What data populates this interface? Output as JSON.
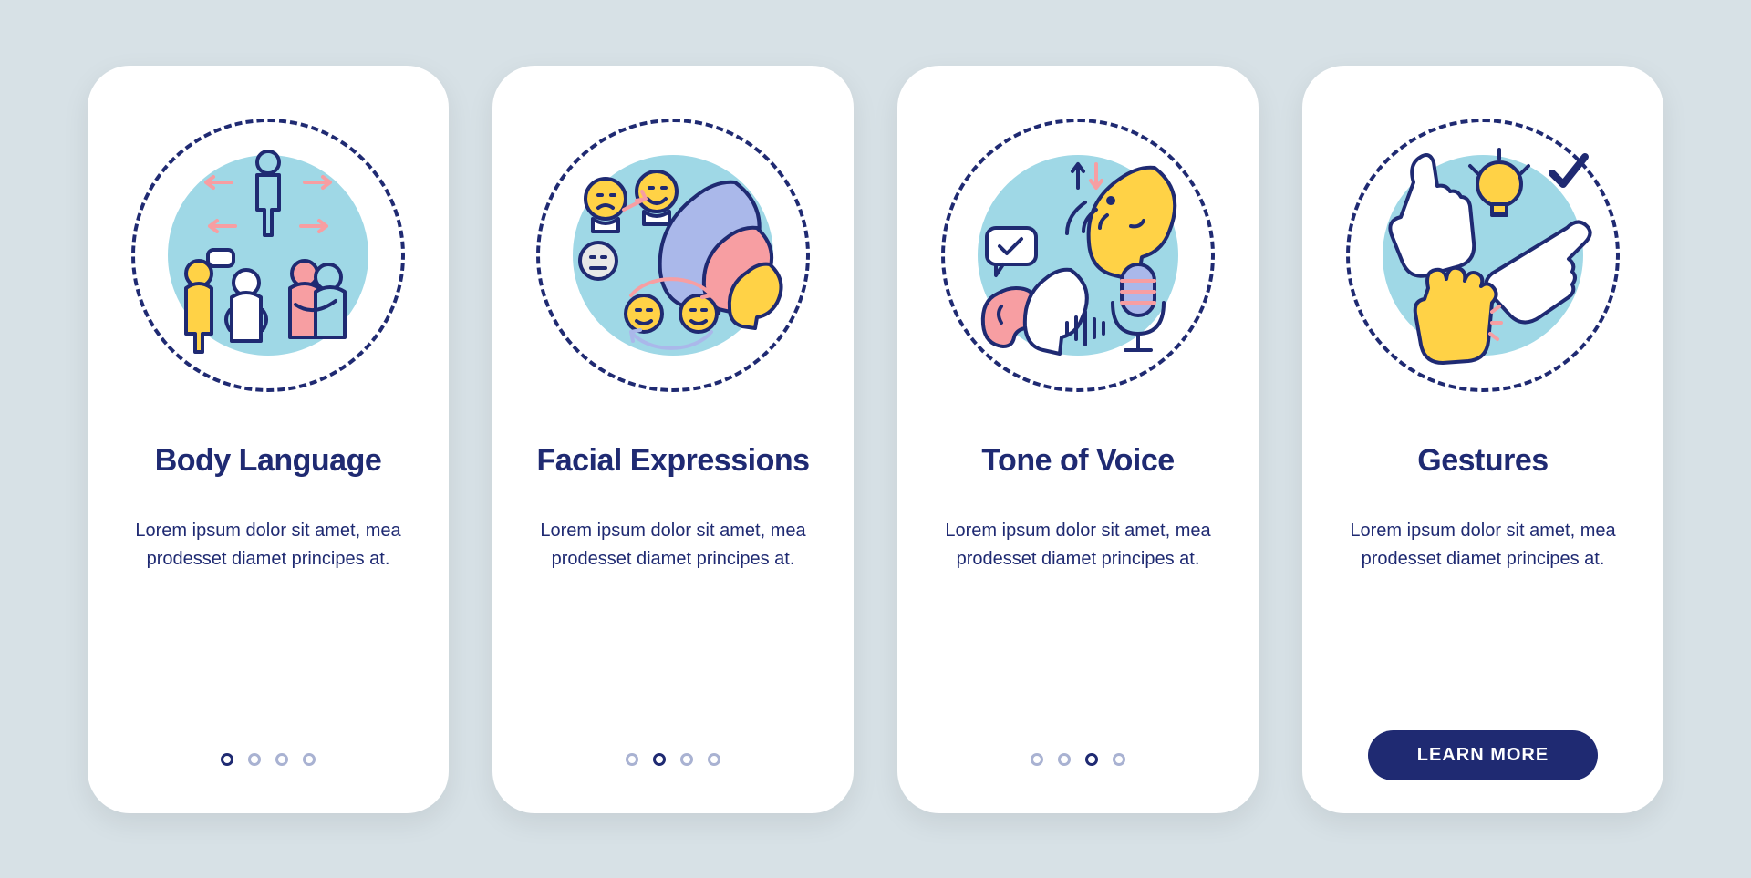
{
  "colors": {
    "background": "#d7e1e6",
    "card": "#ffffff",
    "primary": "#1f2a72",
    "accentBlue": "#9fd8e6",
    "accentYellow": "#ffd246",
    "accentPink": "#f79ea2",
    "dotInactive": "#a9b2d2"
  },
  "cards": [
    {
      "title": "Body Language",
      "body": "Lorem ipsum dolor sit amet, mea prodesset diamet principes at.",
      "activeDot": 0,
      "icon": "body-language-icon",
      "cta": null
    },
    {
      "title": "Facial Expressions",
      "body": "Lorem ipsum dolor sit amet, mea prodesset diamet principes at.",
      "activeDot": 1,
      "icon": "facial-expressions-icon",
      "cta": null
    },
    {
      "title": "Tone of Voice",
      "body": "Lorem ipsum dolor sit amet, mea prodesset diamet principes at.",
      "activeDot": 2,
      "icon": "tone-of-voice-icon",
      "cta": null
    },
    {
      "title": "Gestures",
      "body": "Lorem ipsum dolor sit amet, mea prodesset diamet principes at.",
      "activeDot": null,
      "icon": "gestures-icon",
      "cta": "LEARN MORE"
    }
  ],
  "dotCount": 4
}
